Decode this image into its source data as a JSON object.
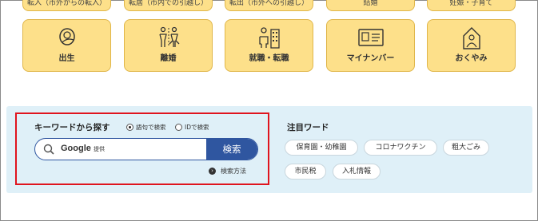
{
  "top_row": [
    {
      "label": "転入（市外からの転入）"
    },
    {
      "label": "転居（市内での引越し）"
    },
    {
      "label": "転出（市外への引越し）"
    },
    {
      "label": "結婚"
    },
    {
      "label": "妊娠・子育て"
    }
  ],
  "categories": [
    {
      "label": "出生",
      "icon": "baby-icon"
    },
    {
      "label": "離婚",
      "icon": "divorce-icon"
    },
    {
      "label": "就職・転職",
      "icon": "job-icon"
    },
    {
      "label": "マイナンバー",
      "icon": "id-card-icon"
    },
    {
      "label": "おくやみ",
      "icon": "condolence-icon"
    }
  ],
  "search": {
    "title": "キーワードから探す",
    "radio_phrase": "語句で検索",
    "radio_id": "IDで検索",
    "selected": "語句で検索",
    "placeholder_brand": "Google",
    "placeholder_suffix": "提供",
    "button": "検索",
    "howto": "検索方法"
  },
  "attention": {
    "title": "注目ワード",
    "words": [
      "保育園・幼稚園",
      "コロナワクチン",
      "粗大ごみ",
      "市民税",
      "入札情報"
    ]
  },
  "colors": {
    "tile": "#fde08a",
    "panel": "#dff0f8",
    "accent": "#2f56a0",
    "highlight": "#e0141e"
  }
}
